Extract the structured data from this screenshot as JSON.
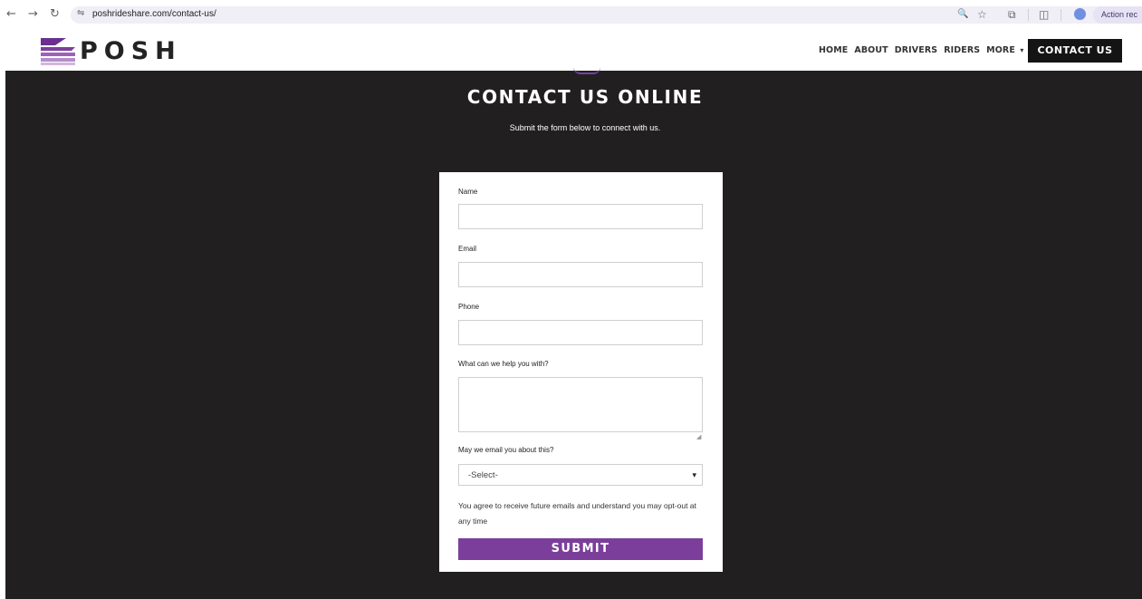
{
  "browser": {
    "back_icon": "←",
    "forward_icon": "→",
    "reload_icon": "↻",
    "site_info_icon": "⇋",
    "url": "poshrideshare.com/contact-us/",
    "zoom_icon": "🔍",
    "bookmark_icon": "☆",
    "extensions_icon": "⧉",
    "sidepanel_icon": "◫",
    "action_label": "Action rec"
  },
  "site": {
    "logo_text": "POSH",
    "nav": [
      {
        "label": "HOME"
      },
      {
        "label": "ABOUT"
      },
      {
        "label": "DRIVERS"
      },
      {
        "label": "RIDERS"
      },
      {
        "label": "MORE"
      }
    ],
    "more_caret": "▾",
    "contact_button": "CONTACT US",
    "brand_color": "#7b3f9b"
  },
  "hero": {
    "title": "CONTACT US ONLINE",
    "subtitle": "Submit the form below to connect with us."
  },
  "form": {
    "name_label": "Name",
    "name_value": "",
    "email_label": "Email",
    "email_value": "",
    "phone_label": "Phone",
    "phone_value": "",
    "help_label": "What can we help you with?",
    "help_value": "",
    "email_permission_label": "May we email you about this?",
    "email_permission_selected": "-Select-",
    "select_caret": "▾",
    "consent_text": "You agree to receive future emails and understand you may opt-out at any time",
    "submit_label": "SUBMIT"
  }
}
